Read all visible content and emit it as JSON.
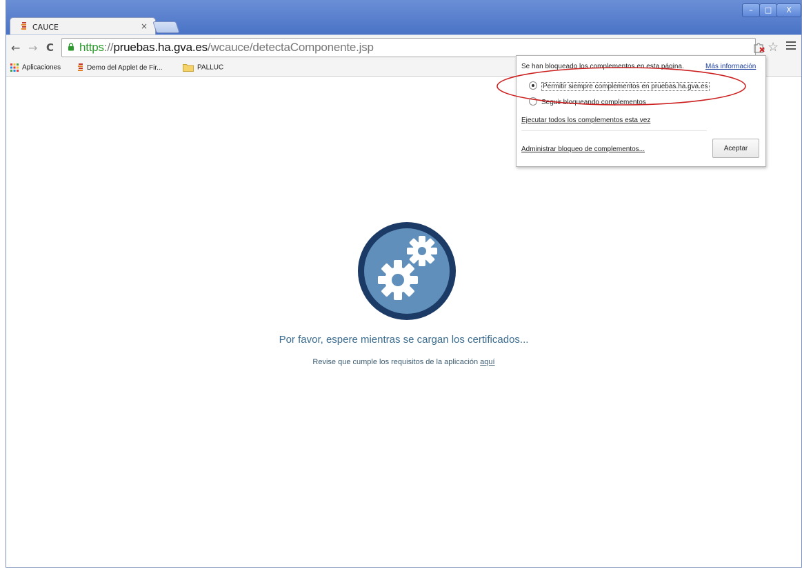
{
  "browser": {
    "tab": {
      "title": "CAUCE",
      "close_glyph": "×"
    },
    "window_controls": {
      "minimize": "–",
      "maximize": "□",
      "close": "X"
    },
    "nav": {
      "back_glyph": "←",
      "forward_glyph": "→",
      "reload_glyph": "C"
    },
    "url": {
      "scheme": "https",
      "sep": "://",
      "host": "pruebas.ha.gva.es",
      "path": "/wcauce/detectaComponente.jsp"
    },
    "icons": {
      "star": "☆",
      "lock": "lock-icon",
      "plugin_blocked": "plugin-blocked-icon",
      "menu": "menu-icon"
    }
  },
  "bookmarks": [
    {
      "label": "Aplicaciones",
      "icon": "apps-grid-icon"
    },
    {
      "label": "Demo del Applet de Fir...",
      "icon": "favicon-icon"
    },
    {
      "label": "PALLUC",
      "icon": "folder-icon"
    }
  ],
  "popup": {
    "message": "Se han bloqueado los complementos en esta página.",
    "more_info": "Más información",
    "option_allow": "Permitir siempre complementos en pruebas.ha.gva.es",
    "option_block": "Seguir bloqueando complementos",
    "run_all": "Ejecutar todos los complementos esta vez",
    "manage": "Administrar bloqueo de complementos...",
    "ok_button": "Aceptar",
    "annotation_color": "#cc1f1f"
  },
  "page": {
    "loading_text": "Por favor, espere mientras se cargan los certificados...",
    "requirements_text": "Revise que cumple los requisitos de la aplicación",
    "requirements_link": "aquí",
    "spinner_icon": "gears-icon",
    "spinner_colors": {
      "ring": "#1c3a66",
      "fill": "#5f8fba",
      "gear": "#ffffff"
    }
  }
}
